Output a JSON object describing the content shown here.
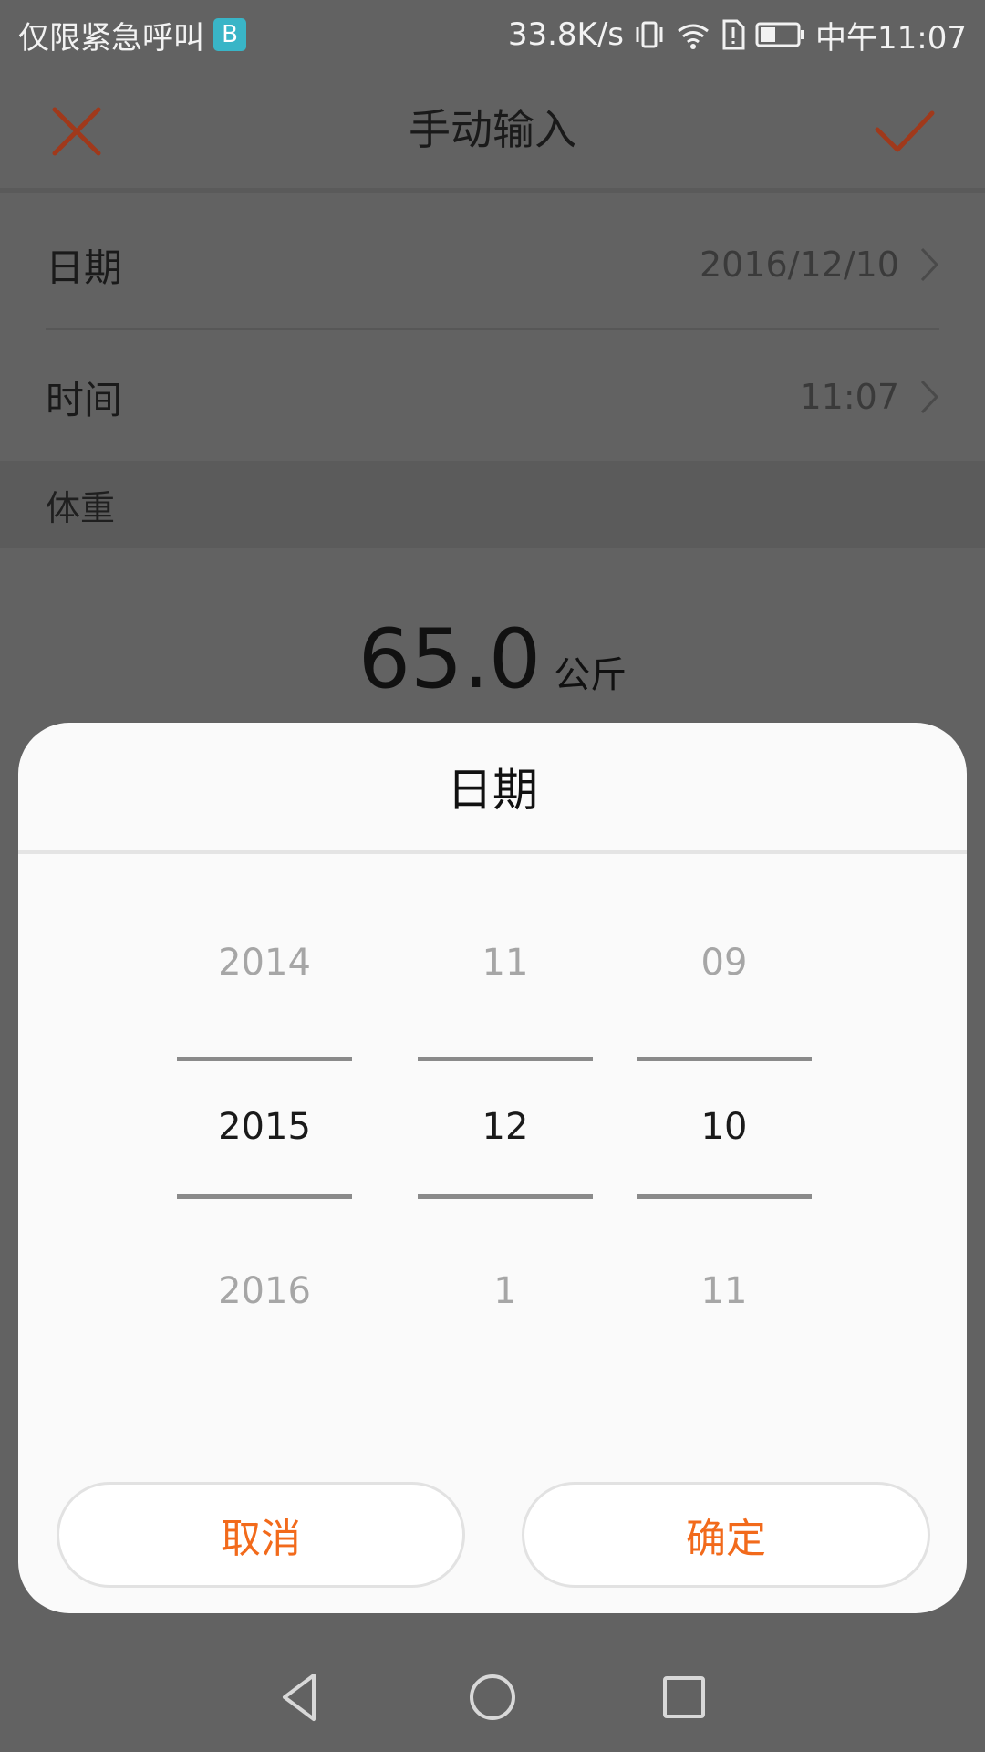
{
  "status_bar": {
    "left_text": "仅限紧急呼叫",
    "app_badge": "B",
    "net_speed": "33.8K/s",
    "time": "中午11:07"
  },
  "header": {
    "title": "手动输入",
    "close_icon": "close-icon",
    "confirm_icon": "check-icon"
  },
  "form": {
    "date_label": "日期",
    "date_value": "2016/12/10",
    "time_label": "时间",
    "time_value": "11:07",
    "section_label": "体重",
    "weight_value": "65.0",
    "weight_unit": "公斤"
  },
  "picker": {
    "title": "日期",
    "year": {
      "prev": "2014",
      "selected": "2015",
      "next": "2016"
    },
    "month": {
      "prev": "11",
      "selected": "12",
      "next": "1"
    },
    "day": {
      "prev": "09",
      "selected": "10",
      "next": "11"
    },
    "cancel_label": "取消",
    "ok_label": "确定"
  },
  "colors": {
    "accent": "#f26a1b",
    "header_icon": "#a0391b",
    "overlay": "#626262"
  },
  "nav": {
    "back": "back-icon",
    "home": "home-icon",
    "recents": "recents-icon"
  }
}
